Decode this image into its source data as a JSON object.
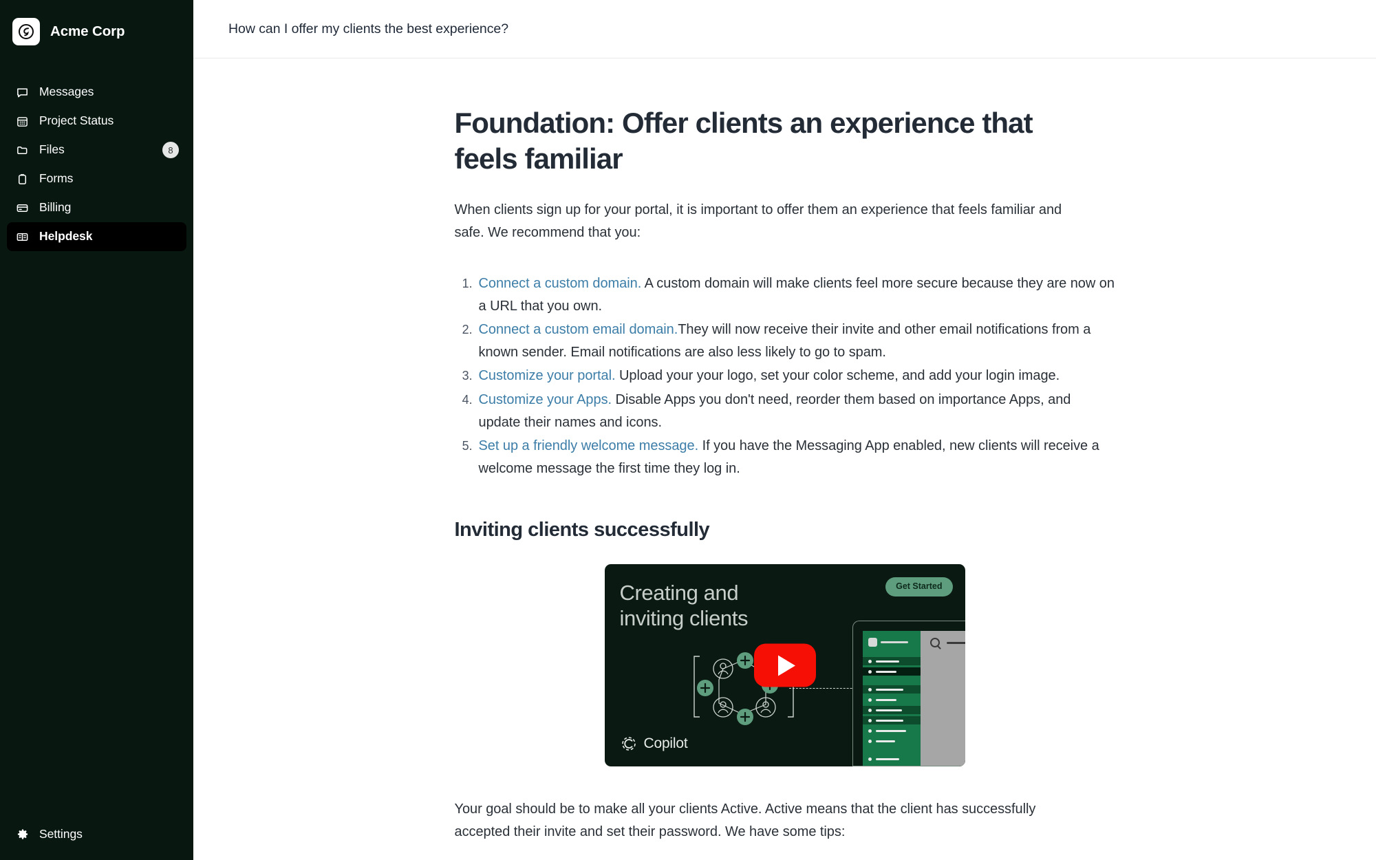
{
  "sidebar": {
    "brand": {
      "name": "Acme Corp",
      "logo_icon": "copilot-logo-icon"
    },
    "items": [
      {
        "label": "Messages",
        "icon": "message-icon",
        "badge": null,
        "active": false
      },
      {
        "label": "Project Status",
        "icon": "calendar-icon",
        "badge": null,
        "active": false
      },
      {
        "label": "Files",
        "icon": "folder-icon",
        "badge": "8",
        "active": false
      },
      {
        "label": "Forms",
        "icon": "clipboard-icon",
        "badge": null,
        "active": false
      },
      {
        "label": "Billing",
        "icon": "credit-card-icon",
        "badge": null,
        "active": false
      },
      {
        "label": "Helpdesk",
        "icon": "book-open-icon",
        "badge": null,
        "active": true
      }
    ],
    "footer": {
      "label": "Settings",
      "icon": "gear-icon"
    }
  },
  "topbar": {
    "title": "How can I offer my clients the best experience?"
  },
  "article": {
    "title": "Foundation: Offer clients an experience that feels familiar",
    "intro": "When clients sign up for your portal, it is important to offer them an experience that feels familiar and safe. We recommend that you:",
    "list": [
      {
        "link": "Connect a custom domain.",
        "rest": " A custom domain will make clients feel more secure because they are now on a URL that you own."
      },
      {
        "link": "Connect a custom email domain.",
        "rest": "They will now receive their invite and other email notifications from a known sender. Email notifications are also less likely to go to spam."
      },
      {
        "link": "Customize your portal.",
        "rest": " Upload your your logo, set your color scheme, and add your login image."
      },
      {
        "link": "Customize your Apps.",
        "rest": " Disable Apps you don't need, reorder them based on importance Apps, and update their names and icons."
      },
      {
        "link": "Set up a friendly welcome message.",
        "rest": " If you have the Messaging App enabled, new clients will receive a welcome message the first time they log in."
      }
    ],
    "subheading": "Inviting clients successfully",
    "video": {
      "title_line1": "Creating and",
      "title_line2": "inviting clients",
      "cta_label": "Get Started",
      "brand_label": "Copilot",
      "play_icon": "youtube-play-icon"
    },
    "tail_para": "Your goal should be to make all your clients Active. Active means that the client has successfully accepted their invite and set their password. We have some tips:"
  },
  "colors": {
    "sidebar_bg": "#081811",
    "sidebar_active_bg": "#000000",
    "link": "#3d7ea8",
    "text": "#2b3138",
    "heading": "#222b36",
    "video_bg": "#0a1a12",
    "video_green": "#17794a",
    "play_red": "#f50f05",
    "badge_bg": "#e5e7e6"
  }
}
